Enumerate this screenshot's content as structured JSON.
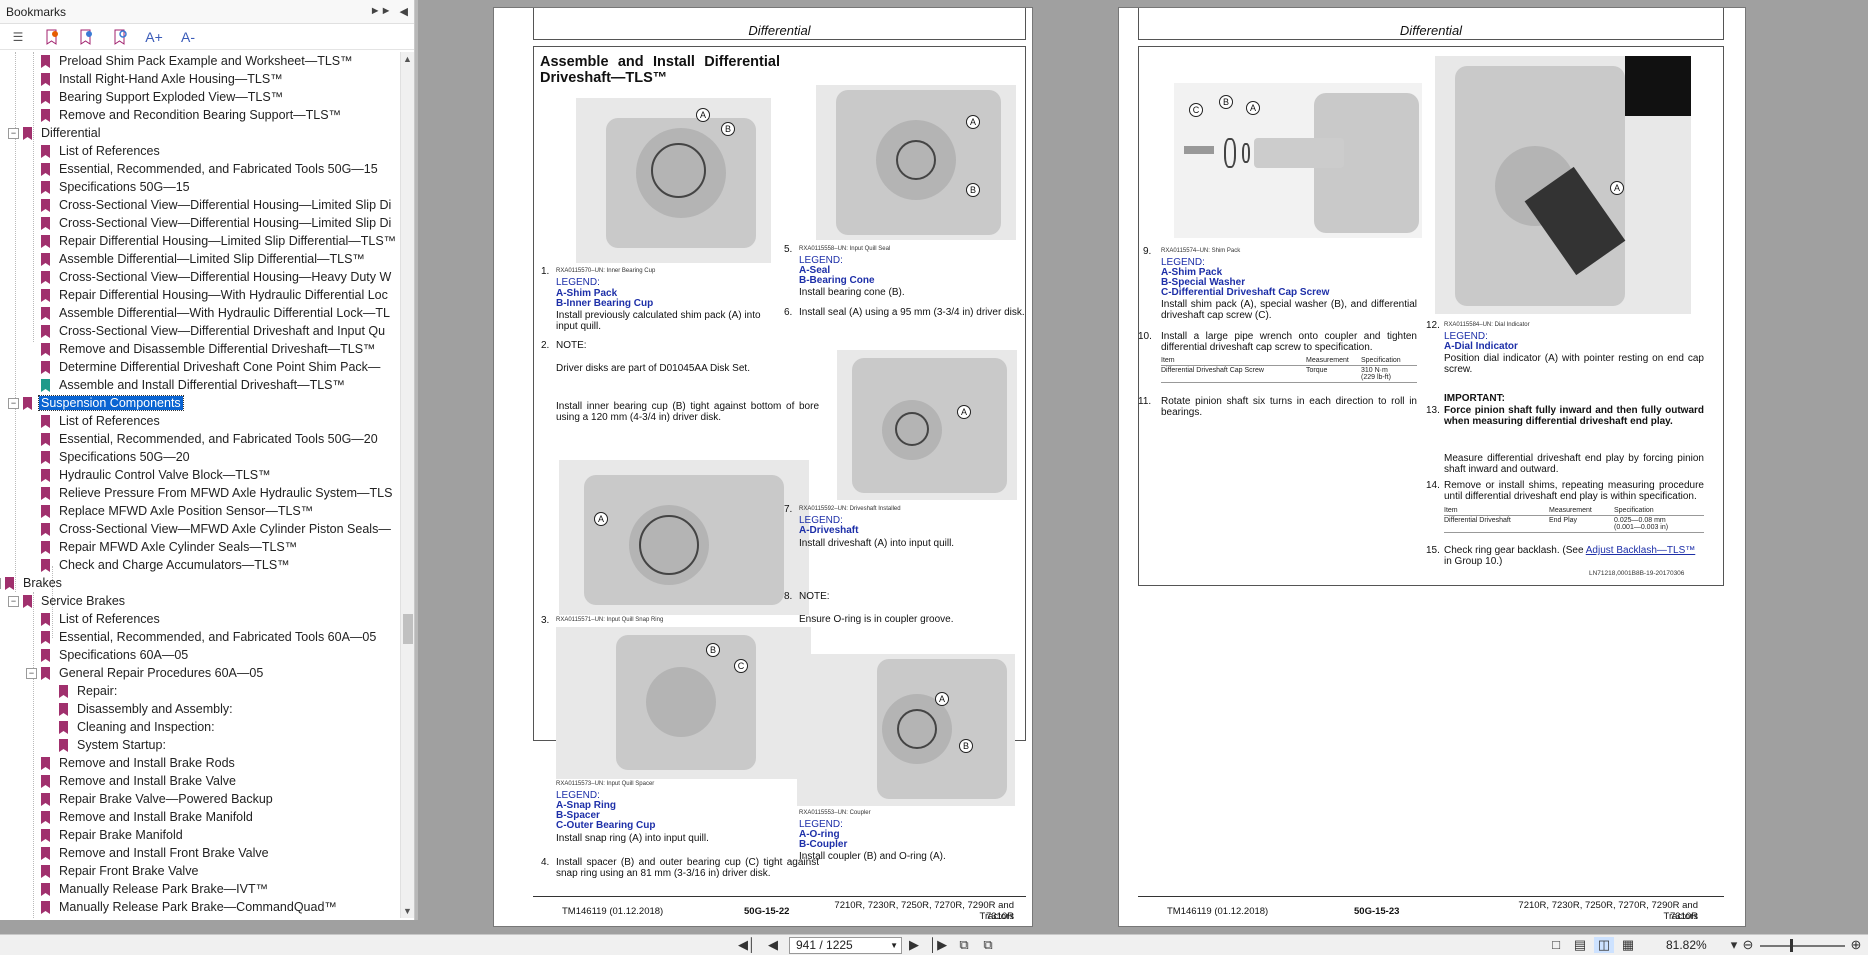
{
  "sidebar": {
    "title": "Bookmarks",
    "toolbar_icons": [
      "list-options-icon",
      "bookmark-add-icon",
      "bookmark-remove-icon",
      "bookmark-find-icon",
      "font-increase-icon",
      "font-decrease-icon"
    ],
    "font_increase_label": "A+",
    "font_decrease_label": "A-",
    "items": [
      {
        "label": "Preload Shim Pack Example and Worksheet—TLS™"
      },
      {
        "label": "Install Right-Hand Axle Housing—TLS™"
      },
      {
        "label": "Bearing Support Exploded View—TLS™"
      },
      {
        "label": "Remove and Recondition Bearing Support—TLS™"
      },
      {
        "label": "Differential"
      },
      {
        "label": "List of References"
      },
      {
        "label": "Essential, Recommended, and Fabricated Tools 50G—15"
      },
      {
        "label": "Specifications 50G—15"
      },
      {
        "label": "Cross-Sectional View—Differential Housing—Limited Slip Di"
      },
      {
        "label": "Cross-Sectional View—Differential Housing—Limited Slip Di"
      },
      {
        "label": "Repair Differential Housing—Limited Slip Differential—TLS™"
      },
      {
        "label": "Assemble Differential—Limited Slip Differential—TLS™"
      },
      {
        "label": "Cross-Sectional View—Differential Housing—Heavy Duty W"
      },
      {
        "label": "Repair Differential Housing—With Hydraulic Differential Loc"
      },
      {
        "label": "Assemble Differential—With Hydraulic Differential Lock—TL"
      },
      {
        "label": "Cross-Sectional View—Differential Driveshaft and Input Qu"
      },
      {
        "label": "Remove and Disassemble Differential Driveshaft—TLS™"
      },
      {
        "label": "Determine Differential Driveshaft Cone Point Shim Pack—"
      },
      {
        "label": "Assemble and Install Differential Driveshaft—TLS™"
      },
      {
        "label": "Suspension Components"
      },
      {
        "label": "List of References"
      },
      {
        "label": "Essential, Recommended, and Fabricated Tools 50G—20"
      },
      {
        "label": "Specifications 50G—20"
      },
      {
        "label": "Hydraulic Control Valve Block—TLS™"
      },
      {
        "label": "Relieve Pressure From MFWD Axle Hydraulic System—TLS"
      },
      {
        "label": "Replace MFWD Axle Position Sensor—TLS™"
      },
      {
        "label": "Cross-Sectional View—MFWD Axle Cylinder Piston Seals—"
      },
      {
        "label": "Repair MFWD Axle Cylinder Seals—TLS™"
      },
      {
        "label": "Check and Charge Accumulators—TLS™"
      },
      {
        "label": "Brakes"
      },
      {
        "label": "Service Brakes"
      },
      {
        "label": "List of References"
      },
      {
        "label": "Essential, Recommended, and Fabricated Tools 60A—05"
      },
      {
        "label": "Specifications 60A—05"
      },
      {
        "label": "General Repair Procedures 60A—05"
      },
      {
        "label": "Repair:"
      },
      {
        "label": "Disassembly and Assembly:"
      },
      {
        "label": "Cleaning and Inspection:"
      },
      {
        "label": "System Startup:"
      },
      {
        "label": "Remove and Install Brake Rods"
      },
      {
        "label": "Remove and Install Brake Valve"
      },
      {
        "label": "Repair Brake Valve—Powered Backup"
      },
      {
        "label": "Remove and Install Brake Manifold"
      },
      {
        "label": "Repair Brake Manifold"
      },
      {
        "label": "Remove and Install Front Brake Valve"
      },
      {
        "label": "Repair Front Brake Valve"
      },
      {
        "label": "Manually Release Park Brake—IVT™"
      },
      {
        "label": "Manually Release Park Brake—CommandQuad™"
      }
    ]
  },
  "left_page": {
    "header": "Differential",
    "title": "Assemble and Install Differential Driveshaft—TLS™",
    "step1": {
      "num": "1.",
      "caption": "RXA0115570–UN: Inner Bearing Cup",
      "legend_title": "LEGEND:",
      "legend": [
        "A-Shim Pack",
        "B-Inner Bearing Cup"
      ],
      "text": "Install previously calculated shim pack (A) into input quill."
    },
    "step2": {
      "num": "2.",
      "note": "NOTE:",
      "note_text": "Driver disks are part of D01045AA Disk Set.",
      "text": "Install inner bearing cup (B) tight against bottom of bore using a 120 mm (4-3/4 in) driver disk."
    },
    "step3": {
      "num": "3.",
      "caption": "RXA0115571–UN: Input Quill Snap Ring",
      "caption2": "RXA0115573–UN: Input Quill Spacer",
      "legend_title": "LEGEND:",
      "legend": [
        "A-Snap Ring",
        "B-Spacer",
        "C-Outer Bearing Cup"
      ],
      "text": "Install snap ring (A) into input quill."
    },
    "step4": {
      "num": "4.",
      "text": "Install spacer (B) and outer bearing cup (C) tight against snap ring using an 81 mm (3-3/16 in) driver disk."
    },
    "step5": {
      "num": "5.",
      "caption": "RXA0115558–UN: Input Quill Seal",
      "legend_title": "LEGEND:",
      "legend": [
        "A-Seal",
        "B-Bearing Cone"
      ],
      "text": "Install bearing cone (B)."
    },
    "step6": {
      "num": "6.",
      "text": "Install seal (A) using a 95 mm (3-3/4 in) driver disk."
    },
    "step7": {
      "num": "7.",
      "caption": "RXA0115592–UN: Driveshaft Installed",
      "legend_title": "LEGEND:",
      "legend": [
        "A-Driveshaft"
      ],
      "text": "Install driveshaft (A) into input quill."
    },
    "step8": {
      "num": "8.",
      "note": "NOTE:",
      "note_text": "Ensure O-ring is in coupler groove.",
      "caption": "RXA0115553–UN: Coupler",
      "legend_title": "LEGEND:",
      "legend": [
        "A-O-ring",
        "B-Coupler"
      ],
      "text": "Install coupler (B) and O-ring (A)."
    },
    "footer": {
      "left": "TM146119 (01.12.2018)",
      "center": "50G-15-22",
      "right1": "7210R, 7230R, 7250R, 7270R, 7290R and 7310R",
      "right2": "Tractors"
    }
  },
  "right_page": {
    "header": "Differential",
    "step9": {
      "num": "9.",
      "caption": "RXA0115574–UN: Shim Pack",
      "legend_title": "LEGEND:",
      "legend": [
        "A-Shim Pack",
        "B-Special Washer",
        "C-Differential Driveshaft Cap Screw"
      ],
      "text": "Install shim pack (A), special washer (B), and differential driveshaft cap screw (C)."
    },
    "step10": {
      "num": "10.",
      "text": "Install a large pipe wrench onto coupler and tighten differential driveshaft cap screw to specification.",
      "table": {
        "headers": [
          "Item",
          "Measurement",
          "Specification"
        ],
        "rows": [
          [
            "Differential Driveshaft Cap Screw",
            "Torque",
            "310 N·m",
            "(229 lb-ft)"
          ]
        ]
      }
    },
    "step11": {
      "num": "11.",
      "text": "Rotate pinion shaft six turns in each direction to roll in bearings."
    },
    "step12": {
      "num": "12.",
      "caption": "RXA0115584–UN: Dial Indicator",
      "legend_title": "LEGEND:",
      "legend": [
        "A-Dial Indicator"
      ],
      "text": "Position dial indicator (A) with pointer resting on end cap screw."
    },
    "important": "IMPORTANT:",
    "step13": {
      "num": "13.",
      "bold_text": "Force pinion shaft fully inward and then fully outward when measuring differential driveshaft end play.",
      "text": "Measure differential driveshaft end play by forcing pinion shaft inward and outward."
    },
    "step14": {
      "num": "14.",
      "text": "Remove or install shims, repeating measuring procedure until differential driveshaft end play is within specification.",
      "table": {
        "headers": [
          "Item",
          "Measurement",
          "Specification"
        ],
        "rows": [
          [
            "Differential Driveshaft",
            "End Play",
            "0.025—0.08 mm",
            "(0.001—0.003 in)"
          ]
        ]
      }
    },
    "step15": {
      "num": "15.",
      "text_pre": "Check ring gear backlash. (See ",
      "link": "Adjust Backlash—TLS™",
      "text_post": " in Group 10.)"
    },
    "doc_id": "LN71218,0001B8B-19-20170306",
    "footer": {
      "left": "TM146119 (01.12.2018)",
      "center": "50G-15-23",
      "right1": "7210R, 7230R, 7250R, 7270R, 7290R and 7310R",
      "right2": "Tractors"
    }
  },
  "navbar": {
    "page_value": "941 / 1225",
    "zoom": "81.82%"
  }
}
